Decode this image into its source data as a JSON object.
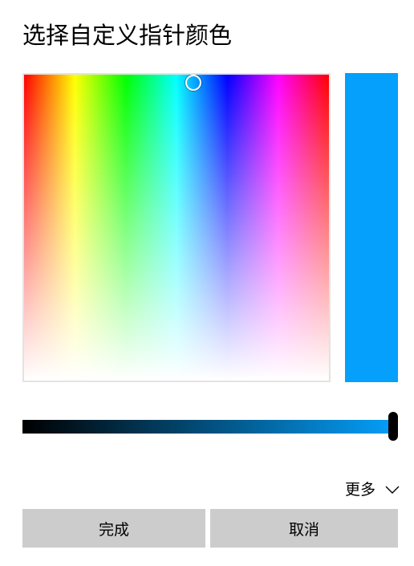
{
  "dialog": {
    "title": "选择自定义指针颜色"
  },
  "color": {
    "selected": "#05a0fc",
    "hue_degrees": 200,
    "saturation": 1.0,
    "value_fraction": 1.0
  },
  "more": {
    "label": "更多",
    "icon": "chevron-down-icon"
  },
  "buttons": {
    "done_label": "完成",
    "cancel_label": "取消"
  },
  "colors": {
    "button_bg": "#cccccc",
    "spectrum_border": "#e3e3e3",
    "slider_thumb": "#000000"
  }
}
